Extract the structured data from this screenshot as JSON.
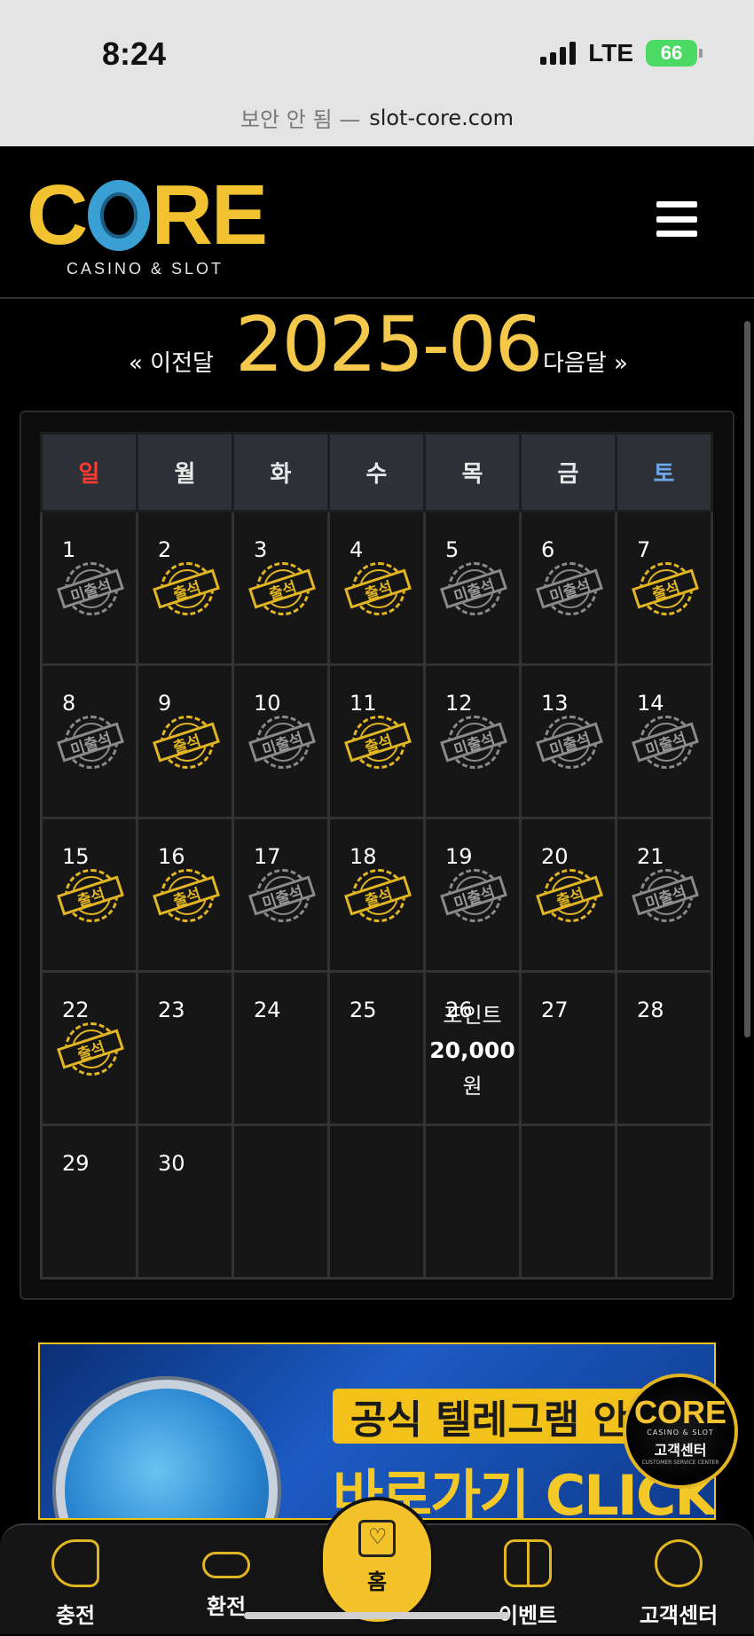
{
  "status_bar": {
    "time": "8:24",
    "network": "LTE",
    "battery": "66"
  },
  "url_bar": {
    "security_warning": "보안 안 됨 —",
    "host": "slot-core.com"
  },
  "header": {
    "logo_text": "CORE",
    "logo_subtitle": "CASINO & SLOT"
  },
  "month_nav": {
    "prev_label": "« 이전달",
    "title": "2025-06",
    "next_label": "다음달 »"
  },
  "calendar": {
    "weekdays": [
      "일",
      "월",
      "화",
      "수",
      "목",
      "금",
      "토"
    ],
    "stamp_labels": {
      "present": "출석",
      "absent": "미출석"
    },
    "weeks": [
      [
        {
          "day": "1",
          "status": "absent"
        },
        {
          "day": "2",
          "status": "present"
        },
        {
          "day": "3",
          "status": "present"
        },
        {
          "day": "4",
          "status": "present"
        },
        {
          "day": "5",
          "status": "absent"
        },
        {
          "day": "6",
          "status": "absent"
        },
        {
          "day": "7",
          "status": "present"
        }
      ],
      [
        {
          "day": "8",
          "status": "absent"
        },
        {
          "day": "9",
          "status": "present"
        },
        {
          "day": "10",
          "status": "absent"
        },
        {
          "day": "11",
          "status": "present"
        },
        {
          "day": "12",
          "status": "absent"
        },
        {
          "day": "13",
          "status": "absent"
        },
        {
          "day": "14",
          "status": "absent"
        }
      ],
      [
        {
          "day": "15",
          "status": "present"
        },
        {
          "day": "16",
          "status": "present"
        },
        {
          "day": "17",
          "status": "absent"
        },
        {
          "day": "18",
          "status": "present"
        },
        {
          "day": "19",
          "status": "absent"
        },
        {
          "day": "20",
          "status": "present"
        },
        {
          "day": "21",
          "status": "absent"
        }
      ],
      [
        {
          "day": "22",
          "status": "present"
        },
        {
          "day": "23",
          "status": ""
        },
        {
          "day": "24",
          "status": ""
        },
        {
          "day": "25",
          "status": ""
        },
        {
          "day": "26",
          "status": "points"
        },
        {
          "day": "27",
          "status": ""
        },
        {
          "day": "28",
          "status": ""
        }
      ],
      [
        {
          "day": "29",
          "status": ""
        },
        {
          "day": "30",
          "status": ""
        },
        {
          "day": "",
          "status": ""
        },
        {
          "day": "",
          "status": ""
        },
        {
          "day": "",
          "status": ""
        },
        {
          "day": "",
          "status": ""
        },
        {
          "day": "",
          "status": ""
        }
      ]
    ],
    "points_cell": {
      "line1": "포인트",
      "amount": "20,000",
      "unit": "원"
    }
  },
  "banner": {
    "title": "공식 텔레그램 안내",
    "cta": "바로가기 CLICK"
  },
  "support_float": {
    "logo": "CORE",
    "subtitle": "CASINO & SLOT",
    "label": "고객센터",
    "small": "CUSTOMER SERVICE CENTER"
  },
  "bottom_nav": {
    "charge": "충전",
    "exchange": "환전",
    "home": "홈",
    "event": "이벤트",
    "support": "고객센터"
  },
  "colors": {
    "gold": "#f3c84b",
    "sunday": "#ff3b30",
    "saturday": "#6ea8e8",
    "absent_stamp": "#8a8a8a"
  }
}
